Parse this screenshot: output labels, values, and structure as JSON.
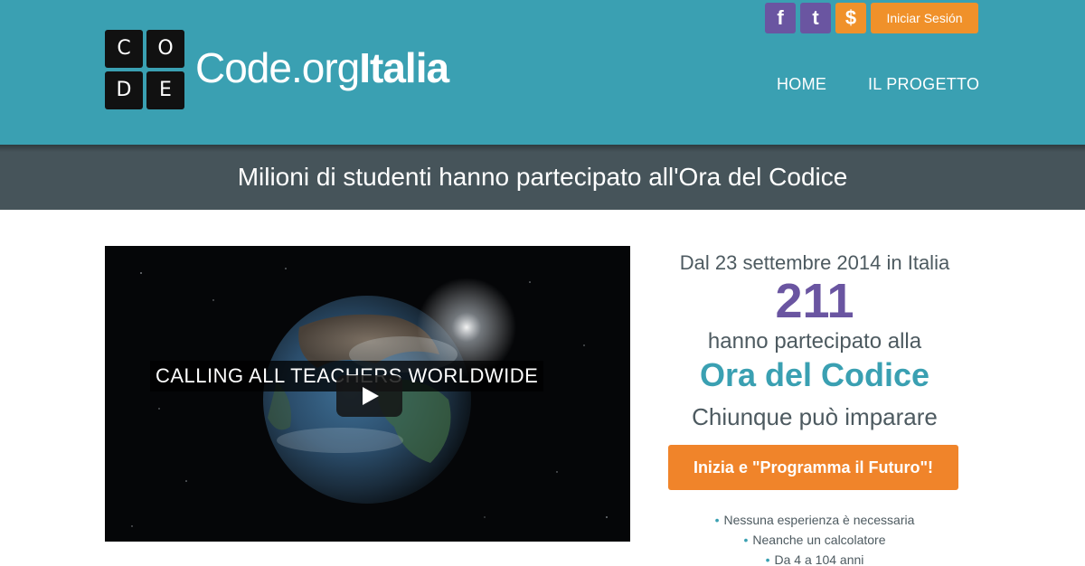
{
  "colors": {
    "header_bg": "#3aa0b2",
    "banner_bg": "#46545a",
    "purple": "#6a55a1",
    "orange": "#f0912a",
    "teal": "#3aa0b2",
    "text_gray": "#4d5a60"
  },
  "logo": {
    "letters": [
      "C",
      "O",
      "D",
      "E"
    ],
    "text_light": "Code.org",
    "text_bold": "Italia"
  },
  "header": {
    "social": [
      {
        "label": "f",
        "icon": "facebook-icon"
      },
      {
        "label": "t",
        "icon": "tumblr-icon"
      },
      {
        "label": "$",
        "icon": "dollar-icon"
      }
    ],
    "login_label": "Iniciar Sesión",
    "nav": [
      "HOME",
      "IL PROGETTO"
    ]
  },
  "banner": {
    "text": "Milioni di studenti hanno partecipato all'Ora del Codice"
  },
  "video": {
    "caption": "CALLING ALL TEACHERS WORLDWIDE",
    "icon": "play-icon"
  },
  "stats": {
    "since": "Dal 23 settembre 2014 in Italia",
    "count": "211",
    "participated": "hanno partecipato alla",
    "hour": "Ora del Codice",
    "anyone": "Chiunque può imparare",
    "cta_label": "Inizia e \"Programma il Futuro\"!",
    "bullets": [
      "Nessuna esperienza è necessaria",
      "Neanche un calcolatore",
      "Da 4 a 104 anni"
    ]
  }
}
